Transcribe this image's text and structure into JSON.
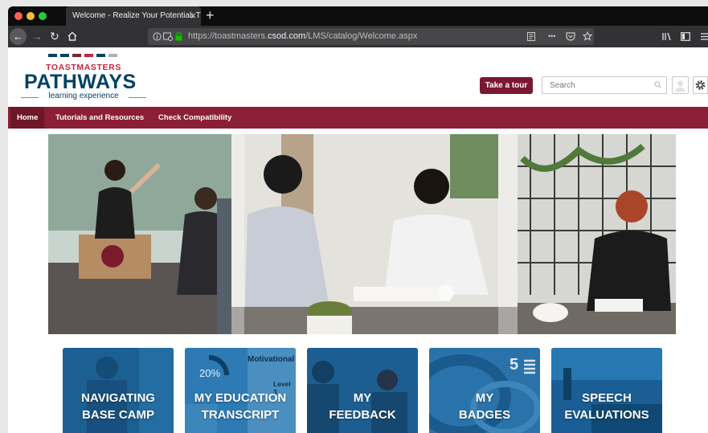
{
  "browser": {
    "tab_title": "Welcome - Realize Your Potential: T",
    "url_prefix": "https://toastmasters.",
    "url_domain": "csod.com",
    "url_path": "/LMS/catalog/Welcome.aspx",
    "menu_dots": "•••"
  },
  "logo": {
    "org": "TOASTMASTERS",
    "name": "PATHWAYS",
    "tagline": "learning experience"
  },
  "header": {
    "tour_label": "Take a tour",
    "search_placeholder": "Search"
  },
  "menu": {
    "items": [
      {
        "label": "Home",
        "active": true
      },
      {
        "label": "Tutorials and Resources",
        "active": false
      },
      {
        "label": "Check Compatibility",
        "active": false
      }
    ]
  },
  "tiles": [
    {
      "label": "NAVIGATING\nBASE CAMP"
    },
    {
      "label": "MY EDUCATION\nTRANSCRIPT",
      "extra": {
        "percent": "20%",
        "title": "Motivational",
        "level": "Level 3"
      }
    },
    {
      "label": "MY\nFEEDBACK"
    },
    {
      "label": "MY\nBADGES",
      "extra": {
        "number": "5"
      }
    },
    {
      "label": "SPEECH\nEVALUATIONS"
    }
  ],
  "colors": {
    "brand_maroon": "#8a1f36",
    "brand_navy": "#004165",
    "brand_red": "#c4273e",
    "tile_blue": "#1f6aa0"
  }
}
